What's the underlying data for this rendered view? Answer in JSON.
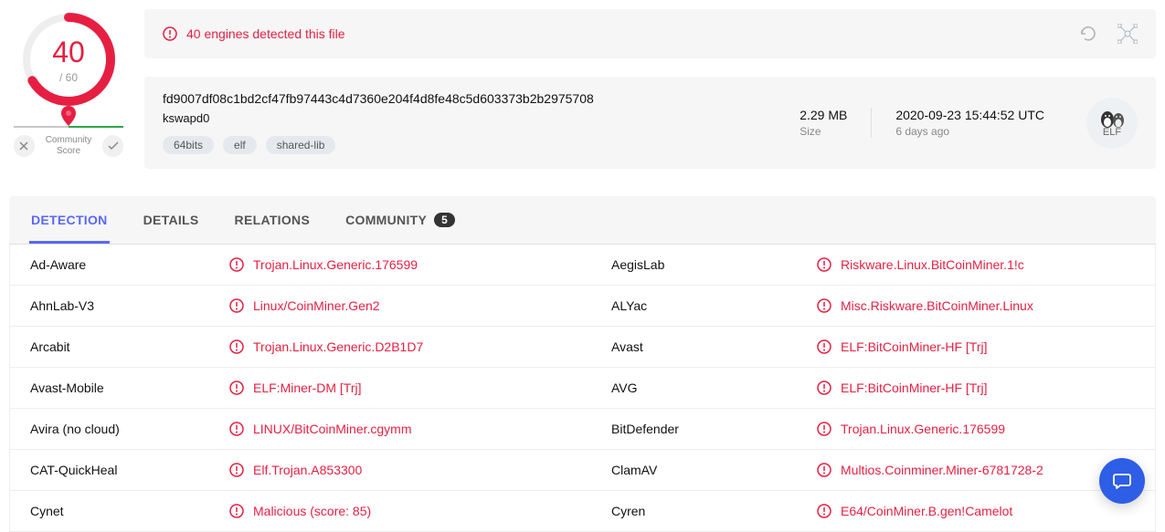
{
  "score": {
    "value": "40",
    "total": "/ 60",
    "community_label": "Community Score"
  },
  "alert": {
    "text": "40 engines detected this file"
  },
  "file": {
    "hash": "fd9007df08c1bd2cf47fb97443c4d7360e204f4d8fe48c5d603373b2b2975708",
    "name": "kswapd0",
    "tags": [
      "64bits",
      "elf",
      "shared-lib"
    ],
    "size": "2.29 MB",
    "size_label": "Size",
    "scan_time": "2020-09-23 15:44:52 UTC",
    "scan_ago": "6 days ago",
    "type_label": "ELF"
  },
  "tabs": {
    "detection": "DETECTION",
    "details": "DETAILS",
    "relations": "RELATIONS",
    "community": "COMMUNITY",
    "community_count": "5"
  },
  "results": [
    {
      "engineL": "Ad-Aware",
      "verdictL": "Trojan.Linux.Generic.176599",
      "engineR": "AegisLab",
      "verdictR": "Riskware.Linux.BitCoinMiner.1!c"
    },
    {
      "engineL": "AhnLab-V3",
      "verdictL": "Linux/CoinMiner.Gen2",
      "engineR": "ALYac",
      "verdictR": "Misc.Riskware.BitCoinMiner.Linux"
    },
    {
      "engineL": "Arcabit",
      "verdictL": "Trojan.Linux.Generic.D2B1D7",
      "engineR": "Avast",
      "verdictR": "ELF:BitCoinMiner-HF [Trj]"
    },
    {
      "engineL": "Avast-Mobile",
      "verdictL": "ELF:Miner-DM [Trj]",
      "engineR": "AVG",
      "verdictR": "ELF:BitCoinMiner-HF [Trj]"
    },
    {
      "engineL": "Avira (no cloud)",
      "verdictL": "LINUX/BitCoinMiner.cgymm",
      "engineR": "BitDefender",
      "verdictR": "Trojan.Linux.Generic.176599"
    },
    {
      "engineL": "CAT-QuickHeal",
      "verdictL": "Elf.Trojan.A853300",
      "engineR": "ClamAV",
      "verdictR": "Multios.Coinminer.Miner-6781728-2"
    },
    {
      "engineL": "Cynet",
      "verdictL": "Malicious (score: 85)",
      "engineR": "Cyren",
      "verdictR": "E64/CoinMiner.B.gen!Camelot"
    }
  ]
}
